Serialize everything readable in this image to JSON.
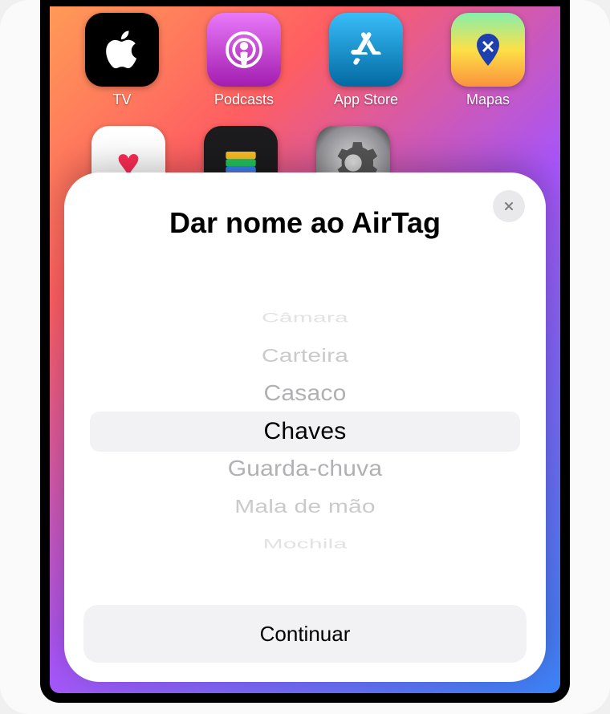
{
  "home": {
    "row1": [
      {
        "label": "TV"
      },
      {
        "label": "Podcasts"
      },
      {
        "label": "App Store"
      },
      {
        "label": "Mapas"
      }
    ]
  },
  "sheet": {
    "title": "Dar nome ao AirTag",
    "picker": {
      "selected_index": 3,
      "items": [
        "Câmara",
        "Carteira",
        "Casaco",
        "Chaves",
        "Guarda-chuva",
        "Mala de mão",
        "Mochila"
      ]
    },
    "continue_label": "Continuar"
  }
}
